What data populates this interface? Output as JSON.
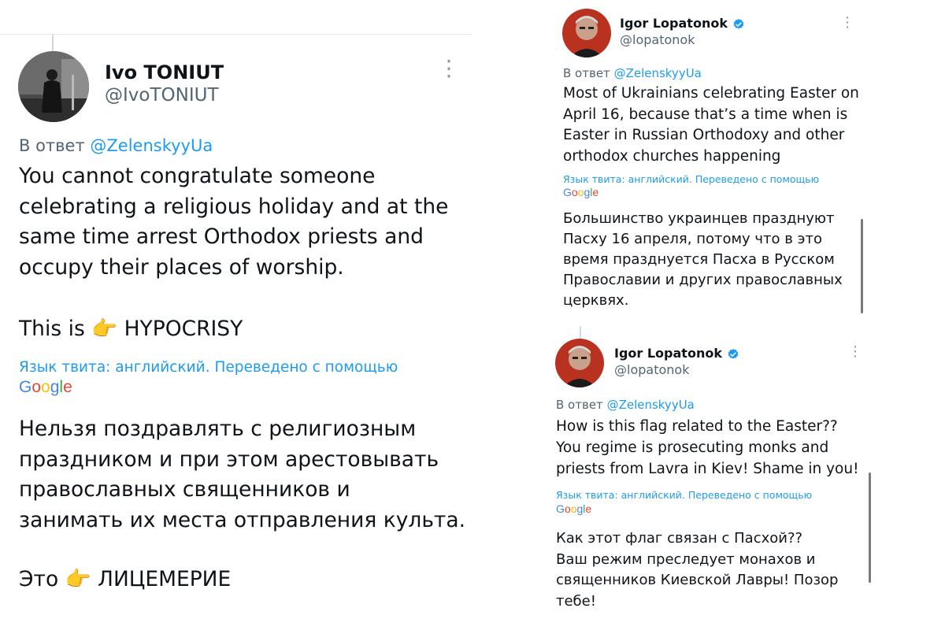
{
  "left_tweet": {
    "author_name": "Ivo TONIUT",
    "author_handle": "@IvoTONIUT",
    "reply_prefix": "В ответ",
    "reply_to": "@ZelenskyyUa",
    "text_en": "You cannot congratulate someone\ncelebrating a religious holiday and at the\nsame time arrest Orthodox priests and\noccupy their places of worship.",
    "emphasis_en_prefix": "This is",
    "emphasis_en_word": "HYPOCRISY",
    "emoji": "👉",
    "translation_note": "Язык твита: английский. Переведено с помощью",
    "google_label": "Google",
    "text_ru": "Нельзя поздравлять с религиозным\nпраздником и при этом арестовывать\nправославных священников и\nзанимать их места отправления культа.",
    "emphasis_ru_prefix": "Это",
    "emphasis_ru_word": "ЛИЦЕМЕРИЕ"
  },
  "right_tweet_1": {
    "author_name": "Igor Lopatonok",
    "author_handle": "@lopatonok",
    "reply_prefix": "В ответ",
    "reply_to": "@ZelenskyyUa",
    "text_en": "Most of Ukrainians celebrating Easter on\nApril 16, because that’s a time when is\nEaster in Russian Orthodoxy and other\northodox churches happening",
    "translation_note": "Язык твита: английский. Переведено с помощью",
    "google_label": "Google",
    "text_ru": "Большинство украинцев празднуют\nПасху 16 апреля, потому что в это\nвремя празднуется Пасха в Русском\nПравославии и других православных\nцерквях."
  },
  "right_tweet_2": {
    "author_name": "Igor Lopatonok",
    "author_handle": "@lopatonok",
    "reply_prefix": "В ответ",
    "reply_to": "@ZelenskyyUa",
    "text_en": "How is this flag related to the Easter??\nYou regime is prosecuting monks and\npriests from Lavra in Kiev! Shame in you!",
    "translation_note": "Язык твита: английский. Переведено с помощью",
    "google_label": "Google",
    "text_ru": "Как этот флаг связан с Пасхой??\nВаш режим преследует монахов и\nсвященников Киевской Лавры! Позор\nтебе!"
  },
  "colors": {
    "link": "#1d9bf0",
    "secondary": "#536471",
    "verified": "#1d9bf0",
    "google_blue": "#4285F4",
    "google_red": "#EA4335",
    "google_yellow": "#FBBC05",
    "google_green": "#34A853"
  },
  "icons": [
    "more-vertical-icon",
    "verified-badge-icon",
    "pointing-right-emoji-icon"
  ]
}
